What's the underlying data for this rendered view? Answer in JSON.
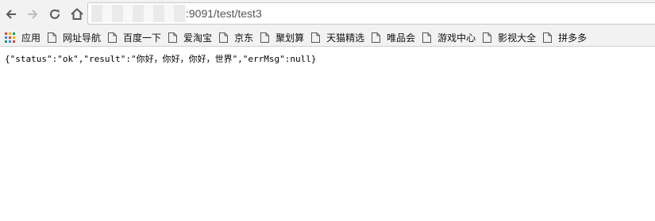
{
  "address_bar": {
    "url_visible": ":9091/test/test3"
  },
  "bookmarks": [
    {
      "label": "应用",
      "icon": "apps-grid-icon"
    },
    {
      "label": "网址导航",
      "icon": "page-icon"
    },
    {
      "label": "百度一下",
      "icon": "page-icon"
    },
    {
      "label": "爱淘宝",
      "icon": "page-icon"
    },
    {
      "label": "京东",
      "icon": "page-icon"
    },
    {
      "label": "聚划算",
      "icon": "page-icon"
    },
    {
      "label": "天猫精选",
      "icon": "page-icon"
    },
    {
      "label": "唯品会",
      "icon": "page-icon"
    },
    {
      "label": "游戏中心",
      "icon": "page-icon"
    },
    {
      "label": "影视大全",
      "icon": "page-icon"
    },
    {
      "label": "拼多多",
      "icon": "page-icon"
    }
  ],
  "page": {
    "body_text": "{\"status\":\"ok\",\"result\":\"你好，你好，你好，世界\",\"errMsg\":null}"
  },
  "colors": {
    "toolbar_bg": "#f2f2f2",
    "apps_colors": [
      "#db4437",
      "#f4b400",
      "#0f9d58",
      "#4285f4"
    ]
  }
}
